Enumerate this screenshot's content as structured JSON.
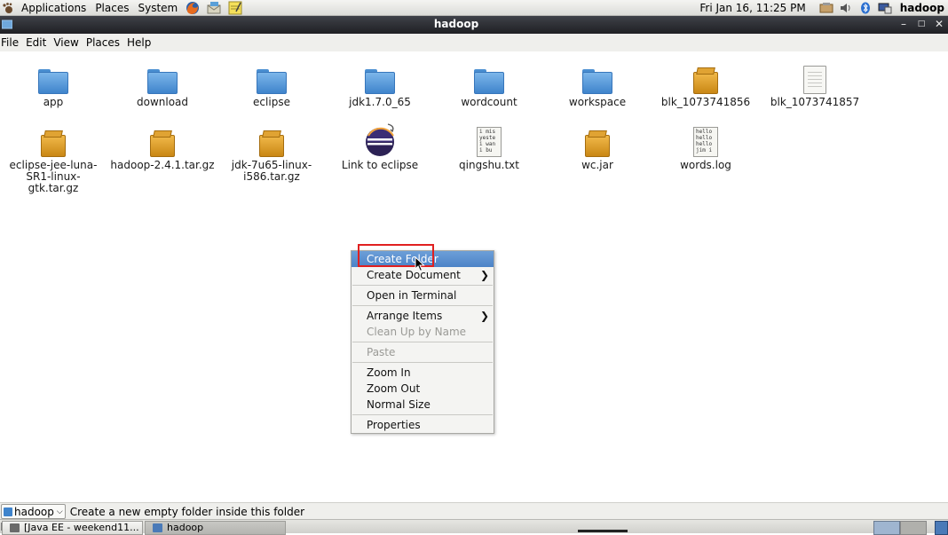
{
  "top_panel": {
    "menus": [
      "Applications",
      "Places",
      "System"
    ],
    "clock": "Fri Jan 16, 11:25 PM",
    "user": "hadoop"
  },
  "window": {
    "title": "hadoop"
  },
  "menubar": [
    "File",
    "Edit",
    "View",
    "Places",
    "Help"
  ],
  "files": [
    {
      "name": "app",
      "kind": "folder"
    },
    {
      "name": "download",
      "kind": "folder"
    },
    {
      "name": "eclipse",
      "kind": "folder"
    },
    {
      "name": "jdk1.7.0_65",
      "kind": "folder"
    },
    {
      "name": "wordcount",
      "kind": "folder"
    },
    {
      "name": "workspace",
      "kind": "folder"
    },
    {
      "name": "blk_1073741856",
      "kind": "package"
    },
    {
      "name": "blk_1073741857",
      "kind": "document"
    },
    {
      "name": "eclipse-jee-luna-SR1-linux-gtk.tar.gz",
      "kind": "package"
    },
    {
      "name": "hadoop-2.4.1.tar.gz",
      "kind": "package"
    },
    {
      "name": "jdk-7u65-linux-i586.tar.gz",
      "kind": "package"
    },
    {
      "name": "Link to eclipse",
      "kind": "link"
    },
    {
      "name": "qingshu.txt",
      "kind": "text",
      "preview": "i mis\nyeste\ni wan\ni bu"
    },
    {
      "name": "wc.jar",
      "kind": "package"
    },
    {
      "name": "words.log",
      "kind": "text",
      "preview": "hello\nhello\nhello\njim i"
    }
  ],
  "context_menu": {
    "items": [
      {
        "label": "Create Folder",
        "state": "highlighted"
      },
      {
        "label": "Create Document",
        "submenu": true
      },
      {
        "sep": true
      },
      {
        "label": "Open in Terminal"
      },
      {
        "sep": true
      },
      {
        "label": "Arrange Items",
        "submenu": true
      },
      {
        "label": "Clean Up by Name",
        "state": "disabled"
      },
      {
        "sep": true
      },
      {
        "label": "Paste",
        "state": "disabled"
      },
      {
        "sep": true
      },
      {
        "label": "Zoom In"
      },
      {
        "label": "Zoom Out"
      },
      {
        "label": "Normal Size"
      },
      {
        "sep": true
      },
      {
        "label": "Properties"
      }
    ]
  },
  "statusbar": {
    "location": "hadoop",
    "message": "Create a new empty folder inside this folder"
  },
  "taskbar": {
    "tasks": [
      {
        "label": "[Java EE - weekend11...",
        "active": false
      },
      {
        "label": "hadoop",
        "active": true
      }
    ]
  },
  "colors": {
    "highlight": "#4c83c7",
    "annotation_box": "#e02020",
    "titlebar": "#2a2b30"
  }
}
